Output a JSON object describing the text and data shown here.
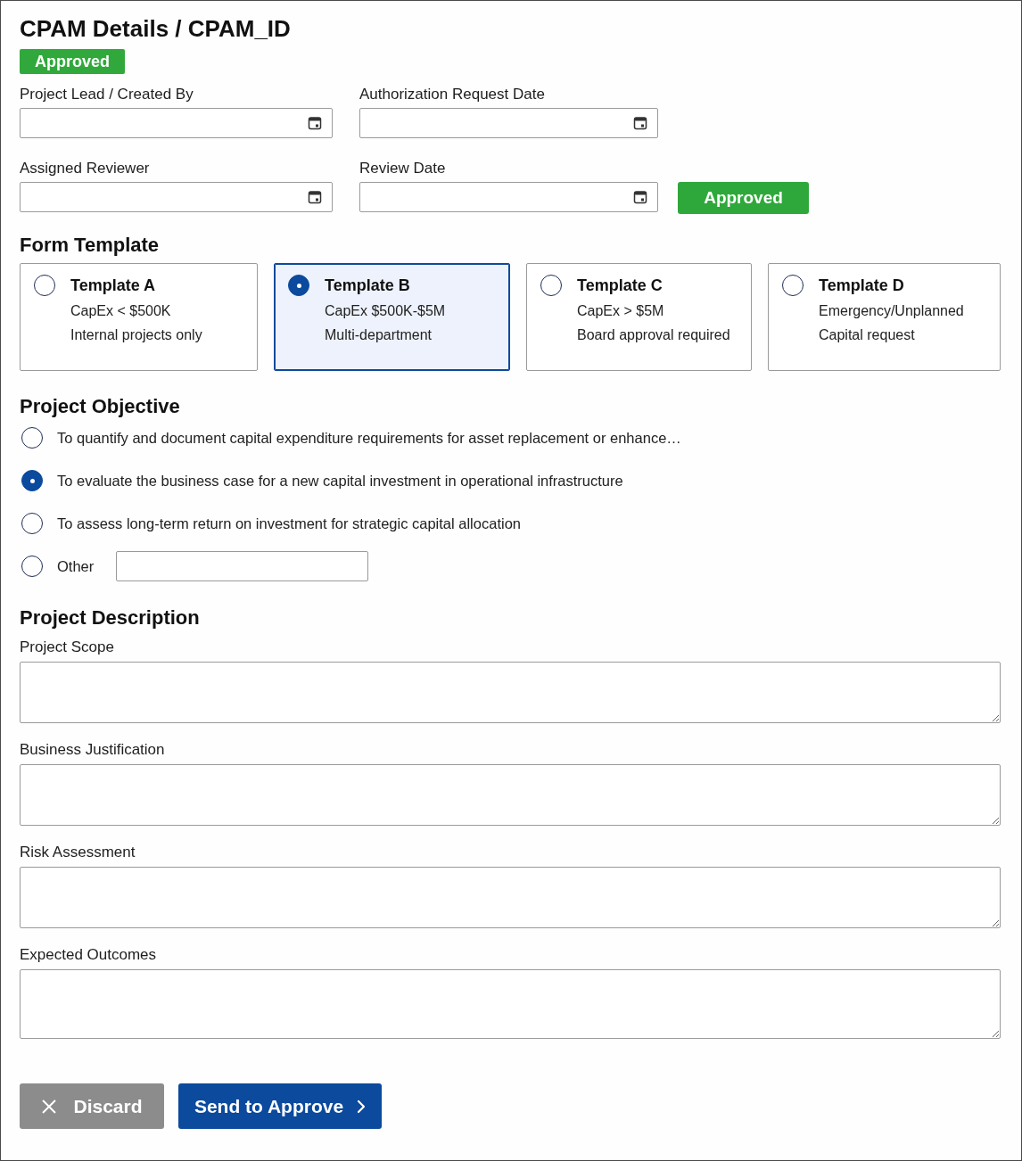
{
  "header": {
    "title": "CPAM Details / CPAM_ID",
    "status_badge": "Approved"
  },
  "details": {
    "rows": [
      {
        "fields": [
          {
            "label": "Project Lead / Created By"
          },
          {
            "label": "Authorization Request Date"
          }
        ]
      },
      {
        "fields": [
          {
            "label": "Assigned Reviewer"
          },
          {
            "label": "Review Date"
          }
        ],
        "action_button": "Approved"
      }
    ]
  },
  "form_template": {
    "heading": "Form Template",
    "options": [
      {
        "title": "Template A",
        "lines": [
          "CapEx < $500K",
          "Internal projects only"
        ],
        "selected": false
      },
      {
        "title": "Template B",
        "lines": [
          "CapEx $500K-$5M",
          "Multi-department"
        ],
        "selected": true
      },
      {
        "title": "Template C",
        "lines": [
          "CapEx > $5M",
          "Board approval required"
        ],
        "selected": false
      },
      {
        "title": "Template D",
        "lines": [
          "Emergency/Unplanned",
          "Capital request"
        ],
        "selected": false
      }
    ]
  },
  "project_objective": {
    "heading": "Project Objective",
    "options": [
      {
        "kind": "choice",
        "label": "To quantify and document capital expenditure requirements for asset replacement or enhance…",
        "selected": false
      },
      {
        "kind": "choice",
        "label": "To evaluate the business case for a new capital investment in operational infrastructure",
        "selected": true
      },
      {
        "kind": "choice",
        "label": "To assess long-term return on investment for strategic capital allocation",
        "selected": false
      },
      {
        "kind": "other",
        "label": "Other",
        "selected": false
      }
    ]
  },
  "project_description": {
    "heading": "Project Description",
    "fields": [
      {
        "label": "Project Scope"
      },
      {
        "label": "Business Justification"
      },
      {
        "label": "Risk Assessment"
      },
      {
        "label": "Expected Outcomes"
      }
    ]
  },
  "actions": [
    {
      "kind": "discard",
      "label": "Discard"
    },
    {
      "kind": "submit",
      "label": "Send to Approve"
    }
  ]
}
